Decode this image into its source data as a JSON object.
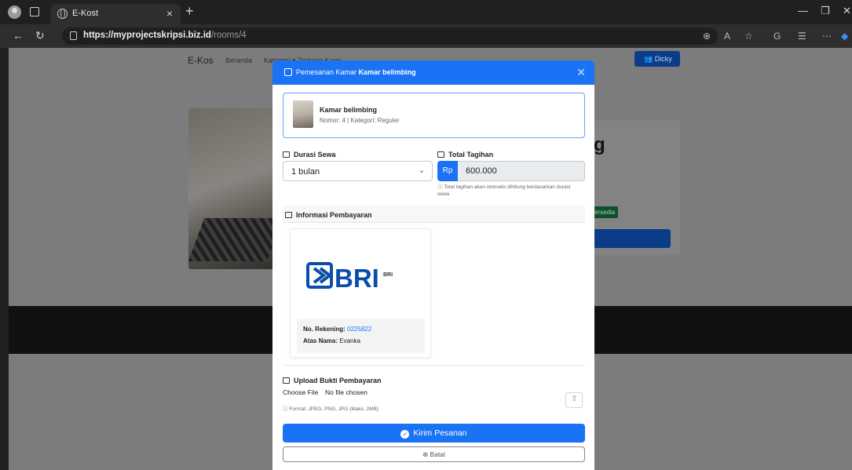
{
  "browser": {
    "tab_title": "E-Kost",
    "tab_close": "×",
    "new_tab": "+",
    "url_host": "https://myprojectskripsi.biz.id",
    "url_path": "/rooms/4",
    "window_controls": [
      "—",
      "❐",
      "✕"
    ]
  },
  "page": {
    "brand": "E-Kos",
    "nav_items": [
      "Beranda",
      "Kategori ▾",
      "Tentang Kami"
    ],
    "user_label": "Dicky",
    "heading_fragment": "g",
    "status_badge": "Tersedia"
  },
  "modal": {
    "title_prefix": "Pemesanan Kamar",
    "title_room": "Kamar belimbing",
    "room_name": "Kamar belimbing",
    "room_meta": "Nomor: 4 | Kategori: Reguler",
    "durasi_label": "Durasi Sewa",
    "durasi_value": "1 bulan",
    "total_label": "Total Tagihan",
    "currency": "Rp",
    "total_value": "600.000",
    "total_hint": "Total tagihan akan otomatis dihitung berdasarkan durasi sewa",
    "payment_section": "Informasi Pembayaran",
    "bank_logo_text": "BRI",
    "bank_name": "BRI",
    "account_label": "No. Rekening:",
    "account_number": "0225822",
    "account_name_label": "Atas Nama:",
    "account_name": "Evanka",
    "upload_label": "Upload Bukti Pembayaran",
    "choose_file": "Choose File",
    "no_file": "No file chosen",
    "format_hint": "Format: JPEG, PNG, JPG (Maks. 2MB)",
    "submit_label": "Kirim Pesanan",
    "cancel_label": "Batal"
  },
  "colors": {
    "primary": "#1a73f5",
    "bri_blue": "#0a4ea8",
    "overlay": "#7c7c7c"
  }
}
